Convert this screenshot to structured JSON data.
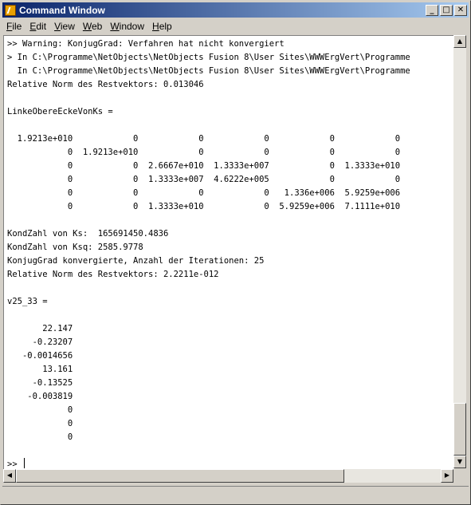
{
  "window": {
    "title": "Command Window",
    "minimize_glyph": "_",
    "maximize_glyph": "□",
    "close_glyph": "✕"
  },
  "menu": [
    "File",
    "Edit",
    "View",
    "Web",
    "Window",
    "Help"
  ],
  "console": {
    "lines": [
      ">> Warning: KonjugGrad: Verfahren hat nicht konvergiert",
      "> In C:\\Programme\\NetObjects\\NetObjects Fusion 8\\User Sites\\WWWErgVert\\Programme",
      "  In C:\\Programme\\NetObjects\\NetObjects Fusion 8\\User Sites\\WWWErgVert\\Programme",
      "Relative Norm des Restvektors: 0.013046",
      "",
      "LinkeObereEckeVonKs =",
      "",
      "  1.9213e+010            0            0            0            0            0",
      "            0  1.9213e+010            0            0            0            0",
      "            0            0  2.6667e+010  1.3333e+007            0  1.3333e+010",
      "            0            0  1.3333e+007  4.6222e+005            0            0",
      "            0            0            0            0   1.336e+006  5.9259e+006",
      "            0            0  1.3333e+010            0  5.9259e+006  7.1111e+010",
      "",
      "KondZahl von Ks:  165691450.4836",
      "KondZahl von Ksq: 2585.9778",
      "KonjugGrad konvergierte, Anzahl der Iterationen: 25",
      "Relative Norm des Restvektors: 2.2211e-012",
      "",
      "v25_33 =",
      "",
      "       22.147",
      "     -0.23207",
      "   -0.0014656",
      "       13.161",
      "     -0.13525",
      "    -0.003819",
      "            0",
      "            0",
      "            0",
      ""
    ],
    "prompt": ">> "
  },
  "scroll_icons": {
    "up": "▲",
    "down": "▼",
    "left": "◀",
    "right": "▶"
  }
}
